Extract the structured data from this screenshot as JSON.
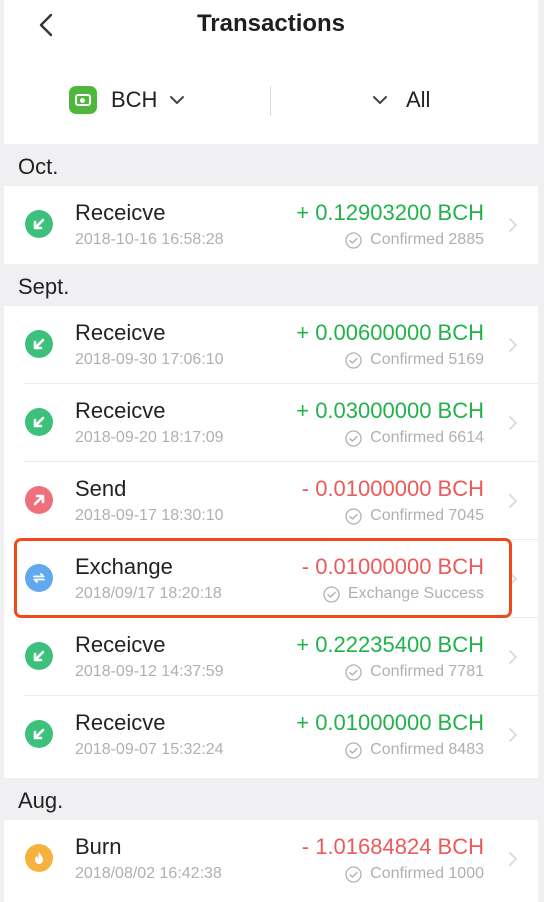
{
  "header": {
    "title": "Transactions",
    "back_icon": "chevron-left-icon"
  },
  "filters": {
    "coin": {
      "logo_icon": "bch-wallet-icon",
      "name": "BCH",
      "logo_color": "#4fb83c"
    },
    "type": {
      "label": "All"
    }
  },
  "colors": {
    "positive": "#21b24a",
    "negative": "#ec5a5a",
    "receive": "#3dc07b",
    "send": "#ef6f7b",
    "exchange": "#62a8ee",
    "burn": "#f7b23e",
    "highlight": "#f04a1a"
  },
  "sections": [
    {
      "label": "Oct."
    },
    {
      "label": "Sept."
    },
    {
      "label": "Aug."
    }
  ],
  "transactions": [
    {
      "kind": "receive",
      "icon": "receive-arrow-icon",
      "type": "Receicve",
      "time": "2018-10-16 16:58:28",
      "amount": "+ 0.12903200 BCH",
      "status": "Confirmed 2885"
    },
    {
      "kind": "receive",
      "icon": "receive-arrow-icon",
      "type": "Receicve",
      "time": "2018-09-30 17:06:10",
      "amount": "+ 0.00600000 BCH",
      "status": "Confirmed 5169"
    },
    {
      "kind": "receive",
      "icon": "receive-arrow-icon",
      "type": "Receicve",
      "time": "2018-09-20 18:17:09",
      "amount": "+ 0.03000000 BCH",
      "status": "Confirmed 6614"
    },
    {
      "kind": "send",
      "icon": "send-arrow-icon",
      "type": "Send",
      "time": "2018-09-17 18:30:10",
      "amount": "- 0.01000000 BCH",
      "status": "Confirmed 7045"
    },
    {
      "kind": "exchange",
      "icon": "exchange-icon",
      "type": "Exchange",
      "time": "2018/09/17 18:20:18",
      "amount": "- 0.01000000 BCH",
      "status": "Exchange Success",
      "highlighted": true
    },
    {
      "kind": "receive",
      "icon": "receive-arrow-icon",
      "type": "Receicve",
      "time": "2018-09-12 14:37:59",
      "amount": "+ 0.22235400 BCH",
      "status": "Confirmed 7781"
    },
    {
      "kind": "receive",
      "icon": "receive-arrow-icon",
      "type": "Receicve",
      "time": "2018-09-07 15:32:24",
      "amount": "+ 0.01000000 BCH",
      "status": "Confirmed 8483"
    },
    {
      "kind": "burn",
      "icon": "flame-icon",
      "type": "Burn",
      "time": "2018/08/02 16:42:38",
      "amount": "- 1.01684824 BCH",
      "status": "Confirmed 1000"
    }
  ]
}
